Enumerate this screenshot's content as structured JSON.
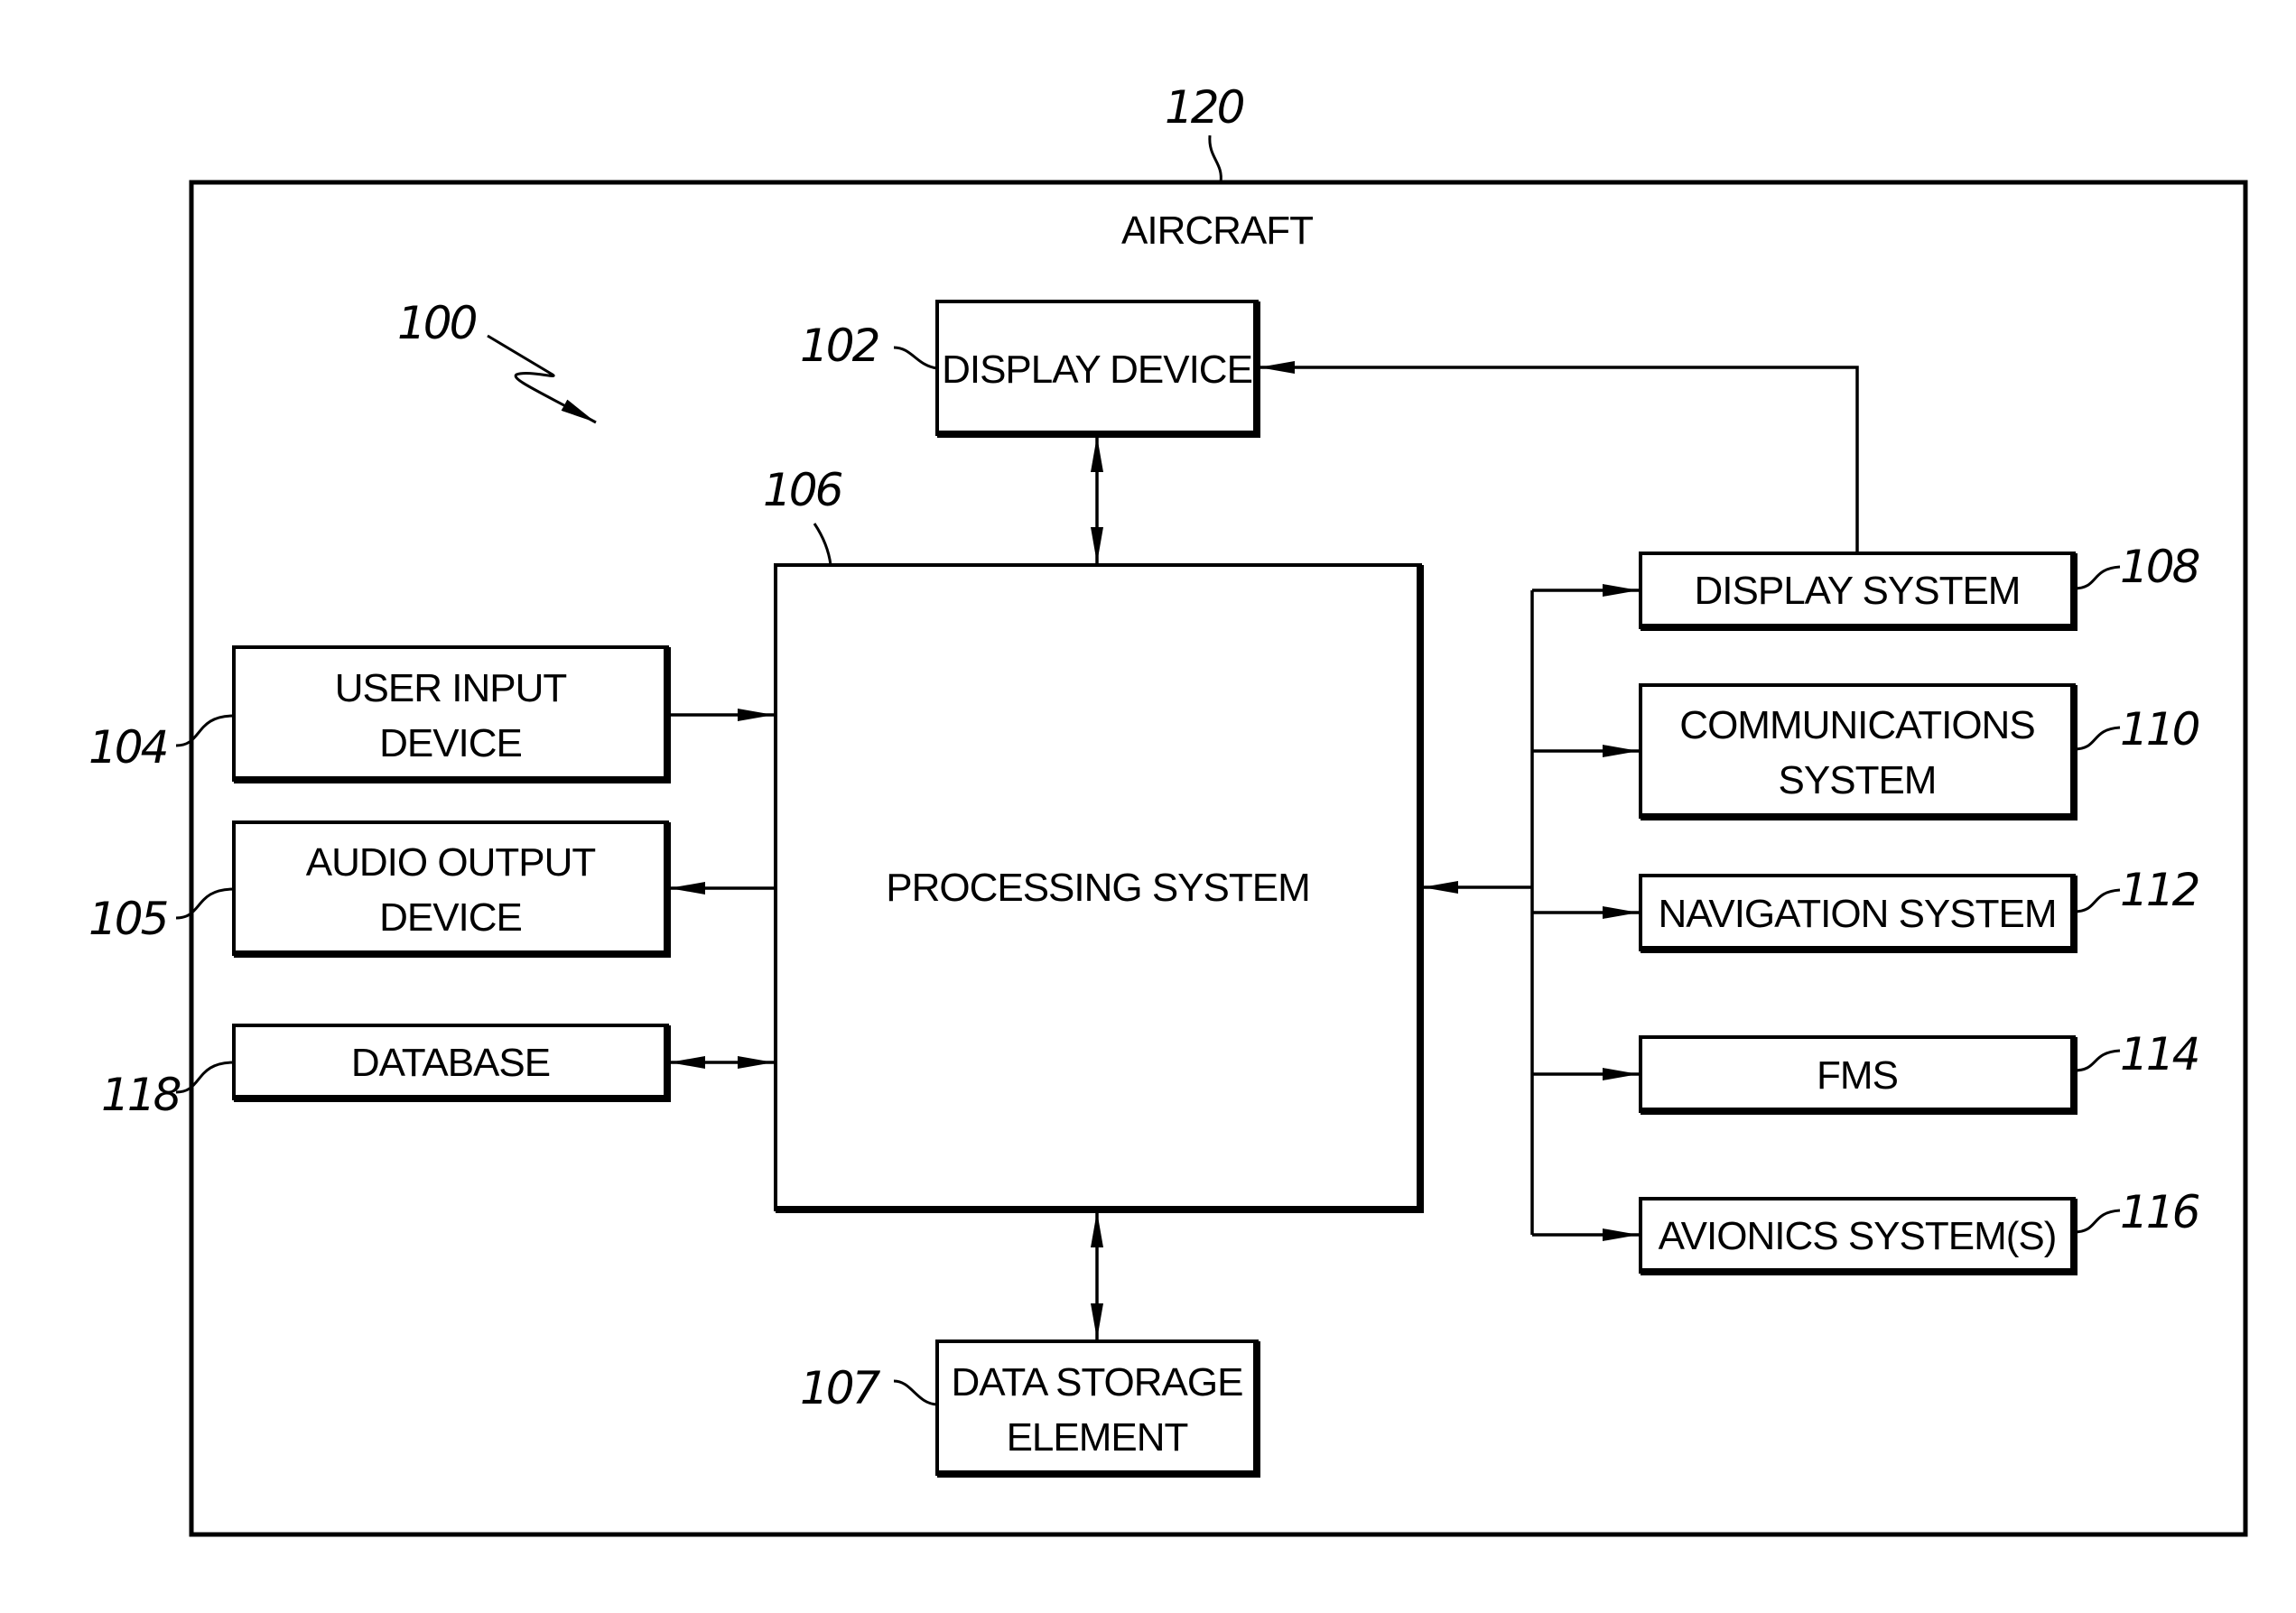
{
  "diagram": {
    "title": "AIRCRAFT",
    "frame_ref": "120",
    "system_ref": "100",
    "blocks": [
      {
        "id": "display_device",
        "ref": "102",
        "lines": [
          "DISPLAY DEVICE"
        ]
      },
      {
        "id": "user_input",
        "ref": "104",
        "lines": [
          "USER INPUT",
          "DEVICE"
        ]
      },
      {
        "id": "audio_output",
        "ref": "105",
        "lines": [
          "AUDIO OUTPUT",
          "DEVICE"
        ]
      },
      {
        "id": "processing",
        "ref": "106",
        "lines": [
          "PROCESSING SYSTEM"
        ]
      },
      {
        "id": "data_storage",
        "ref": "107",
        "lines": [
          "DATA STORAGE",
          "ELEMENT"
        ]
      },
      {
        "id": "display_system",
        "ref": "108",
        "lines": [
          "DISPLAY SYSTEM"
        ]
      },
      {
        "id": "communications",
        "ref": "110",
        "lines": [
          "COMMUNICATIONS",
          "SYSTEM"
        ]
      },
      {
        "id": "navigation",
        "ref": "112",
        "lines": [
          "NAVIGATION SYSTEM"
        ]
      },
      {
        "id": "fms",
        "ref": "114",
        "lines": [
          "FMS"
        ]
      },
      {
        "id": "avionics",
        "ref": "116",
        "lines": [
          "AVIONICS SYSTEM(S)"
        ]
      },
      {
        "id": "database",
        "ref": "118",
        "lines": [
          "DATABASE"
        ]
      }
    ],
    "connections": [
      {
        "from": "processing",
        "to": "display_device",
        "direction": "bidirectional"
      },
      {
        "from": "user_input",
        "to": "processing",
        "direction": "one-way"
      },
      {
        "from": "processing",
        "to": "audio_output",
        "direction": "one-way"
      },
      {
        "from": "processing",
        "to": "database",
        "direction": "bidirectional"
      },
      {
        "from": "processing",
        "to": "data_storage",
        "direction": "bidirectional"
      },
      {
        "from": "display_system",
        "to": "display_device",
        "direction": "one-way"
      },
      {
        "from": "bus",
        "to": "processing",
        "direction": "one-way"
      },
      {
        "from": "bus",
        "to": "display_system",
        "direction": "one-way"
      },
      {
        "from": "bus",
        "to": "communications",
        "direction": "one-way"
      },
      {
        "from": "bus",
        "to": "navigation",
        "direction": "one-way"
      },
      {
        "from": "bus",
        "to": "fms",
        "direction": "one-way"
      },
      {
        "from": "bus",
        "to": "avionics",
        "direction": "one-way"
      }
    ]
  }
}
